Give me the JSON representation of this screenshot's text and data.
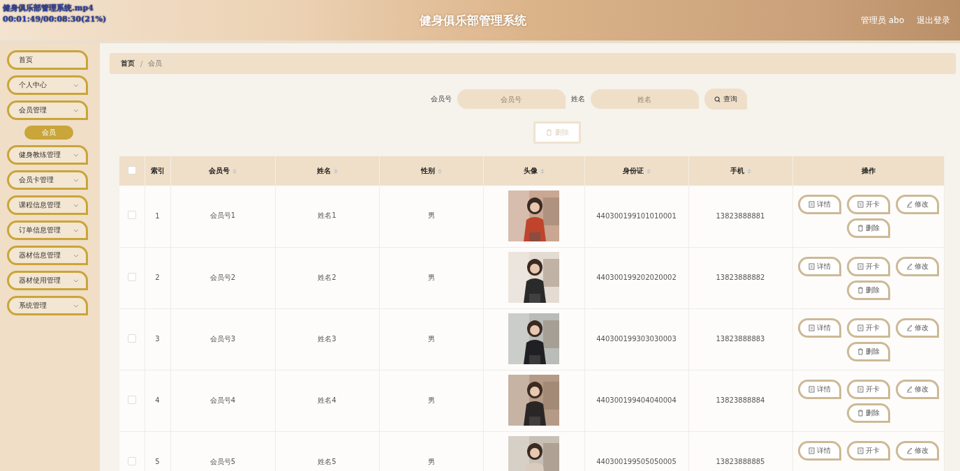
{
  "video_overlay": {
    "filename": "健身俱乐部管理系统.mp4",
    "time": "00:01:49/00:08:30(21%)"
  },
  "header": {
    "title": "健身俱乐部管理系统",
    "user": "管理员 abo",
    "logout": "退出登录"
  },
  "sidebar": {
    "items": [
      {
        "label": "首页",
        "expandable": false
      },
      {
        "label": "个人中心",
        "expandable": true
      },
      {
        "label": "会员管理",
        "expandable": true,
        "children": [
          {
            "label": "会员",
            "selected": true
          }
        ]
      },
      {
        "label": "健身教练管理",
        "expandable": true
      },
      {
        "label": "会员卡管理",
        "expandable": true
      },
      {
        "label": "课程信息管理",
        "expandable": true
      },
      {
        "label": "订单信息管理",
        "expandable": true
      },
      {
        "label": "器材信息管理",
        "expandable": true
      },
      {
        "label": "器材使用管理",
        "expandable": true
      },
      {
        "label": "系统管理",
        "expandable": true
      }
    ]
  },
  "breadcrumb": {
    "items": [
      "首页",
      "会员"
    ],
    "separator": "/"
  },
  "search": {
    "fields": [
      {
        "label": "会员号",
        "placeholder": "会员号"
      },
      {
        "label": "姓名",
        "placeholder": "姓名"
      }
    ],
    "button": "查询"
  },
  "delete_button": {
    "label": "删除",
    "disabled": true
  },
  "table": {
    "all_checked": false,
    "columns": [
      {
        "label": "索引",
        "sortable": false
      },
      {
        "label": "会员号",
        "sortable": true
      },
      {
        "label": "姓名",
        "sortable": true
      },
      {
        "label": "性别",
        "sortable": true
      },
      {
        "label": "头像",
        "sortable": true
      },
      {
        "label": "身份证",
        "sortable": true
      },
      {
        "label": "手机",
        "sortable": true
      },
      {
        "label": "操作",
        "sortable": false
      }
    ],
    "rows": [
      {
        "checked": false,
        "index": "1",
        "member_no": "会员号1",
        "name": "姓名1",
        "gender": "男",
        "avatar": {
          "kind": "picture"
        },
        "id_card": "440300199101010001",
        "phone": "13823888881",
        "actions": [
          "详情",
          "开卡",
          "修改",
          "删除"
        ]
      },
      {
        "checked": false,
        "index": "2",
        "member_no": "会员号2",
        "name": "姓名2",
        "gender": "男",
        "avatar": {
          "kind": "picture"
        },
        "id_card": "440300199202020002",
        "phone": "13823888882",
        "actions": [
          "详情",
          "开卡",
          "修改",
          "删除"
        ]
      },
      {
        "checked": false,
        "index": "3",
        "member_no": "会员号3",
        "name": "姓名3",
        "gender": "男",
        "avatar": {
          "kind": "picture"
        },
        "id_card": "440300199303030003",
        "phone": "13823888883",
        "actions": [
          "详情",
          "开卡",
          "修改",
          "删除"
        ]
      },
      {
        "checked": false,
        "index": "4",
        "member_no": "会员号4",
        "name": "姓名4",
        "gender": "男",
        "avatar": {
          "kind": "picture"
        },
        "id_card": "440300199404040004",
        "phone": "13823888884",
        "actions": [
          "详情",
          "开卡",
          "修改",
          "删除"
        ]
      },
      {
        "checked": false,
        "index": "5",
        "member_no": "会员号5",
        "name": "姓名5",
        "gender": "男",
        "avatar": {
          "kind": "picture"
        },
        "id_card": "440300199505050005",
        "phone": "13823888885",
        "actions": [
          "详情",
          "开卡",
          "修改"
        ]
      }
    ]
  }
}
